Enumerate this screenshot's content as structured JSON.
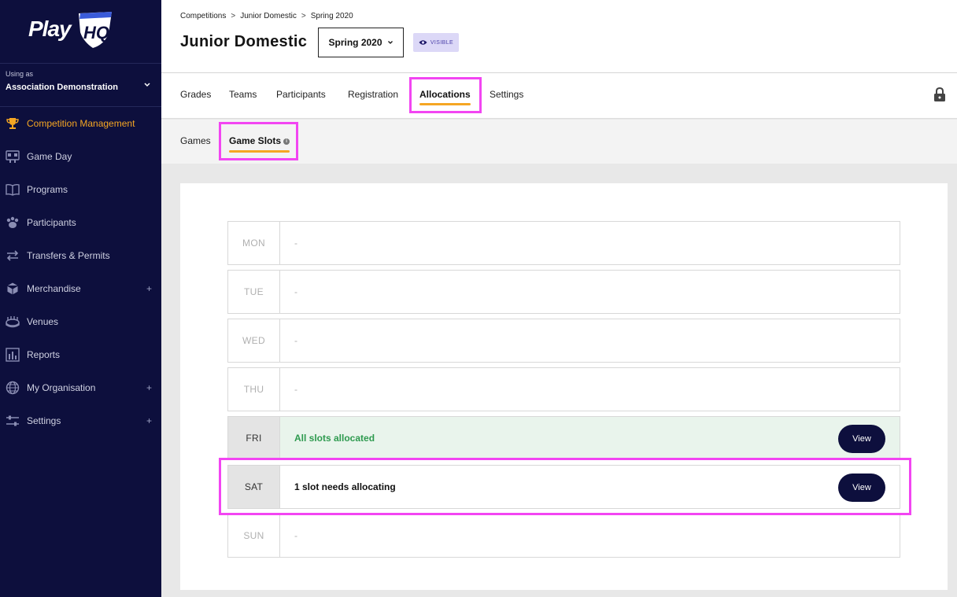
{
  "brand": {
    "logo_text": "Play",
    "logo_mark": "HQ"
  },
  "account": {
    "using_label": "Using as",
    "org_name": "Association Demonstration"
  },
  "nav": {
    "items": [
      {
        "label": "Competition Management",
        "icon": "trophy-icon",
        "active": true
      },
      {
        "label": "Game Day",
        "icon": "scoreboard-icon"
      },
      {
        "label": "Programs",
        "icon": "book-icon"
      },
      {
        "label": "Participants",
        "icon": "paw-icon"
      },
      {
        "label": "Transfers & Permits",
        "icon": "transfer-arrows-icon"
      },
      {
        "label": "Merchandise",
        "icon": "box-icon",
        "expandable": true
      },
      {
        "label": "Venues",
        "icon": "stadium-icon"
      },
      {
        "label": "Reports",
        "icon": "reports-icon"
      },
      {
        "label": "My Organisation",
        "icon": "globe-icon",
        "expandable": true
      },
      {
        "label": "Settings",
        "icon": "sliders-icon",
        "expandable": true
      }
    ],
    "expand_symbol": "+"
  },
  "breadcrumb": {
    "items": [
      "Competitions",
      "Junior Domestic",
      "Spring 2020"
    ],
    "separator": ">"
  },
  "header": {
    "title": "Junior Domestic",
    "season_selector": "Spring 2020",
    "visibility_badge": "VISIBLE"
  },
  "tabs": [
    "Grades",
    "Teams",
    "Participants",
    "Registration",
    "Allocations",
    "Settings"
  ],
  "active_tab": "Allocations",
  "subtabs": [
    "Games",
    "Game Slots"
  ],
  "active_subtab": "Game Slots",
  "days": [
    {
      "day": "MON",
      "message": "-",
      "state": "empty"
    },
    {
      "day": "TUE",
      "message": "-",
      "state": "empty"
    },
    {
      "day": "WED",
      "message": "-",
      "state": "empty"
    },
    {
      "day": "THU",
      "message": "-",
      "state": "empty"
    },
    {
      "day": "FRI",
      "message": "All slots allocated",
      "state": "allocated",
      "action": "View"
    },
    {
      "day": "SAT",
      "message": "1 slot needs allocating",
      "state": "needs",
      "action": "View"
    },
    {
      "day": "SUN",
      "message": "-",
      "state": "empty"
    }
  ],
  "colors": {
    "sidebar": "#0d0f3d",
    "accent": "#f5a623",
    "success": "#2e9a4f",
    "highlight": "#f245f2"
  }
}
